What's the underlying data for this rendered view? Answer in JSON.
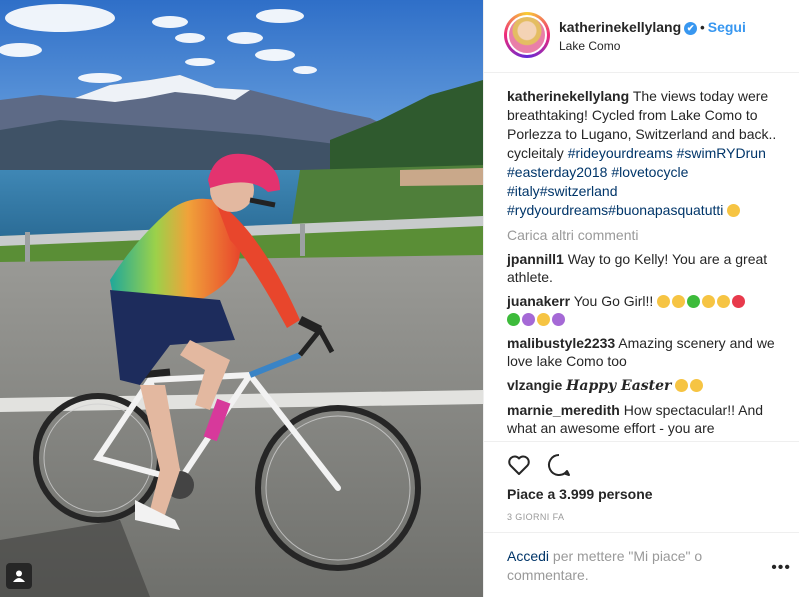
{
  "post": {
    "username": "katherinekellylang",
    "follow_label": "Segui",
    "dot": "•",
    "verified_icon": "✔",
    "location": "Lake Como"
  },
  "caption": {
    "username": "katherinekellylang",
    "text": "The views today were breathtaking! Cycled from Lake Como to Porlezza to Lugano, Switzerland and back.. cycleitaly",
    "tags": [
      "#rideyourdreams",
      "#swimRYDrun",
      "#easterday2018",
      "#lovetocycle",
      "#italy",
      "#switzerland",
      "#rydyourdreams",
      "#buonapasquatutti"
    ]
  },
  "load_more_label": "Carica altri commenti",
  "comments": [
    {
      "username": "jpannill1",
      "text": "Way to go Kelly! You are a great athlete."
    },
    {
      "username": "juanakerr",
      "text": "You Go Girl!!"
    },
    {
      "username": "malibustyle2233",
      "text": "Amazing scenery and we love lake Como too"
    },
    {
      "username": "vlzangie",
      "text": "Happy Easter"
    },
    {
      "username": "marnie_meredith",
      "text": "How spectacular!! And what an awesome effort - you are amazing!!!"
    }
  ],
  "likes_label": "Piace a 3.999 persone",
  "time_label": "3 GIORNI FA",
  "add_comment": {
    "link": "Accedi",
    "text": " per mettere \"Mi piace\" o commentare."
  },
  "more_label": "•••",
  "colors": {
    "link": "#003569",
    "follow": "#3897f0",
    "text": "#262626",
    "muted": "#999999"
  }
}
